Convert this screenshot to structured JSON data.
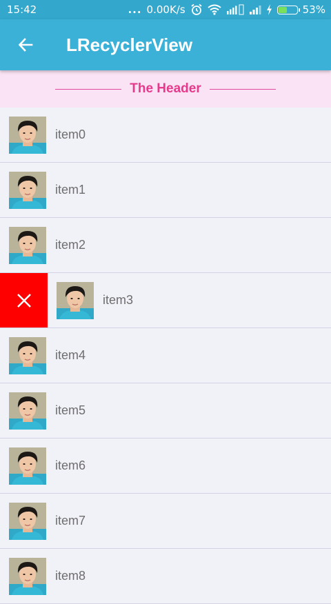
{
  "status_bar": {
    "time": "15:42",
    "dots": "...",
    "network_speed": "0.00K/s",
    "battery_percent": "53%",
    "battery_level": 0.53,
    "icons": [
      "alarm-icon",
      "wifi-icon",
      "hd-signal-icon",
      "signal-icon",
      "charging-icon",
      "battery-icon"
    ]
  },
  "toolbar": {
    "title": "LRecyclerView",
    "back_icon": "arrow-left-icon"
  },
  "header": {
    "text": "The Header"
  },
  "list": {
    "items": [
      {
        "label": "item0"
      },
      {
        "label": "item1"
      },
      {
        "label": "item2"
      },
      {
        "label": "item3",
        "swiped": true
      },
      {
        "label": "item4"
      },
      {
        "label": "item5"
      },
      {
        "label": "item6"
      },
      {
        "label": "item7"
      },
      {
        "label": "item8"
      }
    ],
    "delete_icon": "close-icon"
  },
  "colors": {
    "status_bar": "#33a7cc",
    "toolbar": "#3cb1d8",
    "header_bg": "#f9e3f4",
    "header_text": "#e63a8c",
    "delete_bg": "#ff0000",
    "list_bg": "#f1f1f8"
  }
}
